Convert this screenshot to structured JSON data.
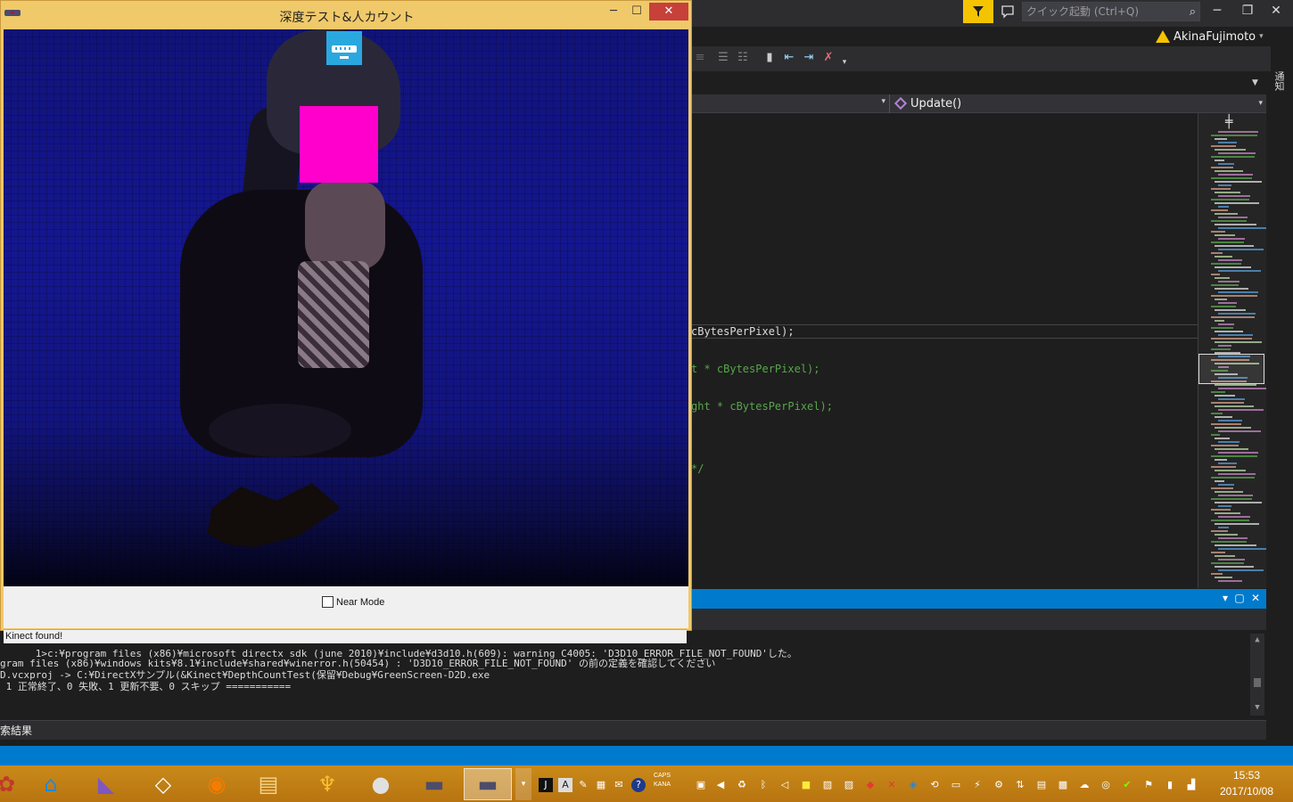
{
  "kinect_window": {
    "title": "深度テスト&人カウント",
    "minimize": "─",
    "maximize": "☐",
    "close": "✕",
    "near_mode_label": "Near Mode",
    "status_text": "Kinect found!"
  },
  "vs": {
    "search_placeholder": "クイック起動 (Ctrl+Q)",
    "account_name": "AkinaFujimoto",
    "notifications_label": "通知",
    "nav_member": "Update()",
    "code_lines": [
      {
        "text": "cBytesPerPixel);",
        "color": "#dcdcdc"
      },
      {
        "text": "t * cBytesPerPixel);",
        "color": "#57a64a"
      },
      {
        "text": "ght * cBytesPerPixel);",
        "color": "#57a64a"
      },
      {
        "text": "*/",
        "color": "#57a64a"
      }
    ],
    "output_lines": [
      "                                                                                                         してください",
      "      1>c:¥program files (x86)¥microsoft directx sdk (june 2010)¥include¥d3d10.h(609): warning C4005: 'D3D10_ERROR_FILE_NOT_FOUND'した。",
      "gram files (x86)¥windows kits¥8.1¥include¥shared¥winerror.h(50454) : 'D3D10_ERROR_FILE_NOT_FOUND' の前の定義を確認してください",
      "D.vcxproj -> C:¥DirectXサンプル(&Kinect¥DepthCountTest(保留¥Debug¥GreenScreen-D2D.exe",
      " 1 正常終了、0 失敗、1 更新不要、0 スキップ ==========="
    ],
    "bottom_tab": "索結果"
  },
  "taskbar": {
    "apps": [
      {
        "name": "app-partial-icon",
        "glyph": "✿",
        "color": "#c0392b"
      },
      {
        "name": "app-blue-icon",
        "glyph": "⌂",
        "color": "#1e88e5"
      },
      {
        "name": "visual-studio-icon",
        "glyph": "◣",
        "color": "#7e57c2"
      },
      {
        "name": "unity-icon",
        "glyph": "◇",
        "color": "#ffffff"
      },
      {
        "name": "blender-icon",
        "glyph": "◉",
        "color": "#f57c00"
      },
      {
        "name": "file-explorer-icon",
        "glyph": "▤",
        "color": "#f4d58d"
      },
      {
        "name": "app-flame-icon",
        "glyph": "♆",
        "color": "#fbc02d"
      },
      {
        "name": "app-sphere-icon",
        "glyph": "●",
        "color": "#e0e0e0"
      },
      {
        "name": "kinect-app-icon",
        "glyph": "▬",
        "color": "#4d4d6b"
      },
      {
        "name": "kinect-app-active-icon",
        "glyph": "▬",
        "color": "#4d4d6b"
      }
    ],
    "caps_label": "CAPS",
    "kana_label": "KANA",
    "time": "15:53",
    "date": "2017/10/08"
  },
  "colors": {
    "vs_blue": "#007acc",
    "taskbar_orange": "#c98a1a",
    "kinect_title": "#f0c96a",
    "head_marker": "#ff00cc",
    "sensor_badge": "#29a8e0"
  }
}
